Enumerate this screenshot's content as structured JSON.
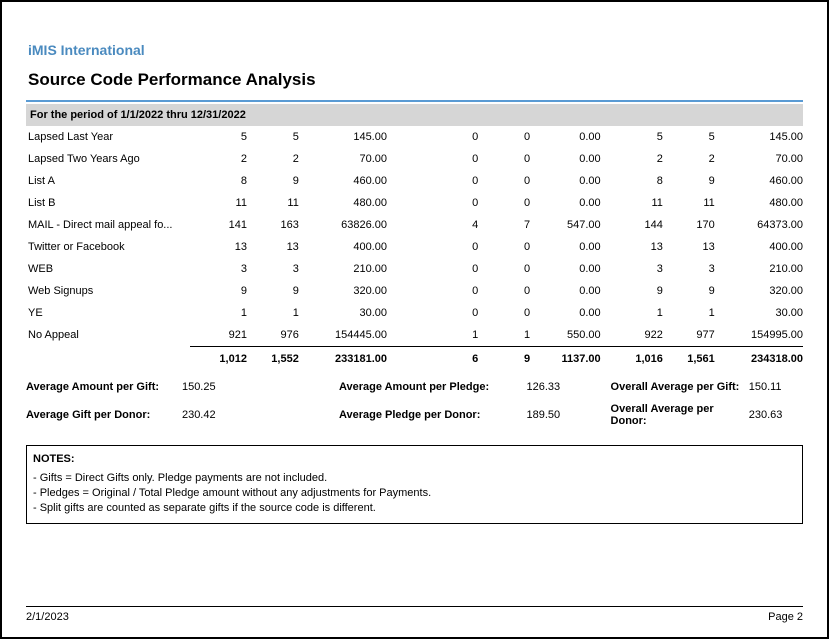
{
  "org": "iMIS International",
  "title": "Source Code Performance Analysis",
  "period": "For the period of 1/1/2022 thru 12/31/2022",
  "rows": [
    {
      "label": "Lapsed Last Year",
      "c1": "5",
      "c2": "5",
      "c3": "145.00",
      "c4": "0",
      "c5": "0",
      "c6": "0.00",
      "c7": "5",
      "c8": "5",
      "c9": "145.00"
    },
    {
      "label": "Lapsed Two Years Ago",
      "c1": "2",
      "c2": "2",
      "c3": "70.00",
      "c4": "0",
      "c5": "0",
      "c6": "0.00",
      "c7": "2",
      "c8": "2",
      "c9": "70.00"
    },
    {
      "label": "List A",
      "c1": "8",
      "c2": "9",
      "c3": "460.00",
      "c4": "0",
      "c5": "0",
      "c6": "0.00",
      "c7": "8",
      "c8": "9",
      "c9": "460.00"
    },
    {
      "label": "List B",
      "c1": "11",
      "c2": "11",
      "c3": "480.00",
      "c4": "0",
      "c5": "0",
      "c6": "0.00",
      "c7": "11",
      "c8": "11",
      "c9": "480.00"
    },
    {
      "label": "MAIL - Direct mail appeal fo...",
      "c1": "141",
      "c2": "163",
      "c3": "63826.00",
      "c4": "4",
      "c5": "7",
      "c6": "547.00",
      "c7": "144",
      "c8": "170",
      "c9": "64373.00"
    },
    {
      "label": "Twitter or Facebook",
      "c1": "13",
      "c2": "13",
      "c3": "400.00",
      "c4": "0",
      "c5": "0",
      "c6": "0.00",
      "c7": "13",
      "c8": "13",
      "c9": "400.00"
    },
    {
      "label": "WEB",
      "c1": "3",
      "c2": "3",
      "c3": "210.00",
      "c4": "0",
      "c5": "0",
      "c6": "0.00",
      "c7": "3",
      "c8": "3",
      "c9": "210.00"
    },
    {
      "label": "Web Signups",
      "c1": "9",
      "c2": "9",
      "c3": "320.00",
      "c4": "0",
      "c5": "0",
      "c6": "0.00",
      "c7": "9",
      "c8": "9",
      "c9": "320.00"
    },
    {
      "label": "YE",
      "c1": "1",
      "c2": "1",
      "c3": "30.00",
      "c4": "0",
      "c5": "0",
      "c6": "0.00",
      "c7": "1",
      "c8": "1",
      "c9": "30.00"
    },
    {
      "label": "No Appeal",
      "c1": "921",
      "c2": "976",
      "c3": "154445.00",
      "c4": "1",
      "c5": "1",
      "c6": "550.00",
      "c7": "922",
      "c8": "977",
      "c9": "154995.00"
    }
  ],
  "totals": {
    "label": "",
    "c1": "1,012",
    "c2": "1,552",
    "c3": "233181.00",
    "c4": "6",
    "c5": "9",
    "c6": "1137.00",
    "c7": "1,016",
    "c8": "1,561",
    "c9": "234318.00"
  },
  "avg": {
    "r1": {
      "l1": "Average Amount per Gift:",
      "v1": "150.25",
      "l2": "Average Amount per Pledge:",
      "v2": "126.33",
      "l3": "Overall Average per Gift:",
      "v3": "150.11"
    },
    "r2": {
      "l1": "Average Gift per Donor:",
      "v1": "230.42",
      "l2": "Average Pledge per Donor:",
      "v2": "189.50",
      "l3": "Overall Average per Donor:",
      "v3": "230.63"
    }
  },
  "notes": {
    "title": "NOTES:",
    "n1": "- Gifts = Direct Gifts only. Pledge payments are not included.",
    "n2": "- Pledges = Original / Total Pledge amount without any adjustments for Payments.",
    "n3": "- Split gifts are counted as separate gifts if the source code is different."
  },
  "footer": {
    "date": "2/1/2023",
    "page": "Page 2"
  }
}
